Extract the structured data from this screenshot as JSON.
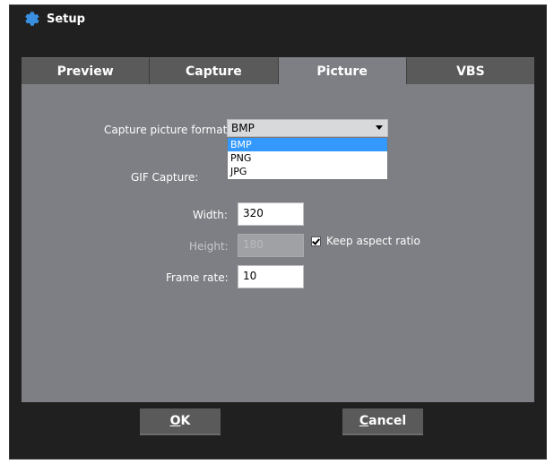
{
  "window": {
    "title": "Setup",
    "icon": "gear-icon"
  },
  "tabs": [
    {
      "label": "Preview",
      "active": false
    },
    {
      "label": "Capture",
      "active": false
    },
    {
      "label": "Picture",
      "active": true
    },
    {
      "label": "VBS",
      "active": false
    }
  ],
  "picture": {
    "format_label": "Capture picture format:",
    "format_value": "BMP",
    "format_options": [
      "BMP",
      "PNG",
      "JPG"
    ],
    "format_selected_index": 0,
    "gif_label": "GIF Capture:",
    "width_label": "Width:",
    "width_value": "320",
    "height_label": "Height:",
    "height_value": "180",
    "keep_aspect_label": "Keep aspect ratio",
    "keep_aspect_checked": true,
    "frame_rate_label": "Frame rate:",
    "frame_rate_value": "10"
  },
  "buttons": {
    "ok_mnemonic": "O",
    "ok_rest": "K",
    "cancel_mnemonic": "C",
    "cancel_rest": "ancel"
  },
  "colors": {
    "accent": "#3399ff",
    "dialog_bg": "#202020",
    "panel_bg": "#7d7f84",
    "tab_bg": "#5a5a5a"
  }
}
